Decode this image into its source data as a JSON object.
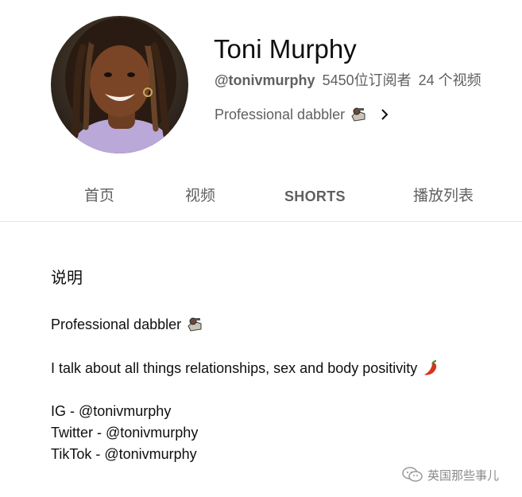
{
  "channel": {
    "name": "Toni Murphy",
    "handle": "@tonivmurphy",
    "subscribers": "5450位订阅者",
    "videos": "24 个视频",
    "tagline": "Professional dabbler",
    "tagline_emoji_icon": "brain-with-tools-icon"
  },
  "tabs": [
    {
      "label": "首页"
    },
    {
      "label": "视频"
    },
    {
      "label": "SHORTS"
    },
    {
      "label": "播放列表"
    }
  ],
  "about": {
    "title": "说明",
    "lines": [
      "Professional dabbler",
      "I talk about all things relationships, sex and body positivity",
      "IG - @tonivmurphy",
      "Twitter - @tonivmurphy",
      "TikTok - @tonivmurphy"
    ],
    "line_emoji_icons": [
      "brain-with-tools-icon",
      "chili-pepper-icon"
    ]
  },
  "watermark": {
    "text": "英国那些事儿",
    "icon": "wechat-logo-icon"
  },
  "colors": {
    "primary_text": "#0f0f0f",
    "secondary_text": "#606060",
    "divider": "#e5e5e5",
    "watermark": "#8a8a8a"
  }
}
